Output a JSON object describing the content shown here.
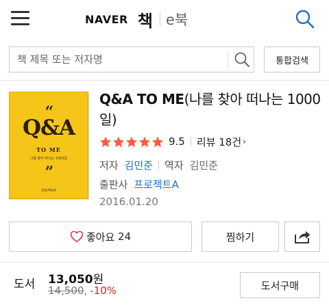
{
  "header": {
    "brand_naver": "NAVER",
    "brand_book": "책",
    "brand_ebook": "e북"
  },
  "search": {
    "placeholder": "책 제목 또는 저자명",
    "scope_label": "통합검색"
  },
  "book": {
    "title_main": "Q&A TO ME",
    "title_sub": "(나를 찾아 떠나는 1000일)",
    "cover": {
      "quote_open": "“",
      "title": "Q&A",
      "subtitle": "TO ME",
      "tagline": "나를 찾아 떠나는 1000일",
      "quote_close": "”",
      "publisher_mark": "프로젝트A"
    },
    "rating": {
      "score": "9.5",
      "stars": 5,
      "review_label": "리뷰 18건"
    },
    "author_label": "저자",
    "author": "김민준",
    "translator_label": "역자",
    "translator": "김민준",
    "publisher_label": "출판사",
    "publisher": "프로젝트A",
    "pub_date": "2016.01.20"
  },
  "actions": {
    "like_label": "좋아요",
    "like_count": "24",
    "wish_label": "찜하기"
  },
  "price": {
    "type_label": "도서",
    "amount": "13,050",
    "currency": "원",
    "original": "14,500",
    "original_suffix": ",",
    "discount": "-10%",
    "buy_label": "도서구매"
  },
  "colors": {
    "link": "#1f6fc0",
    "star": "#ff5a3c",
    "discount": "#e02020",
    "cover_bg": "#f6c519"
  }
}
